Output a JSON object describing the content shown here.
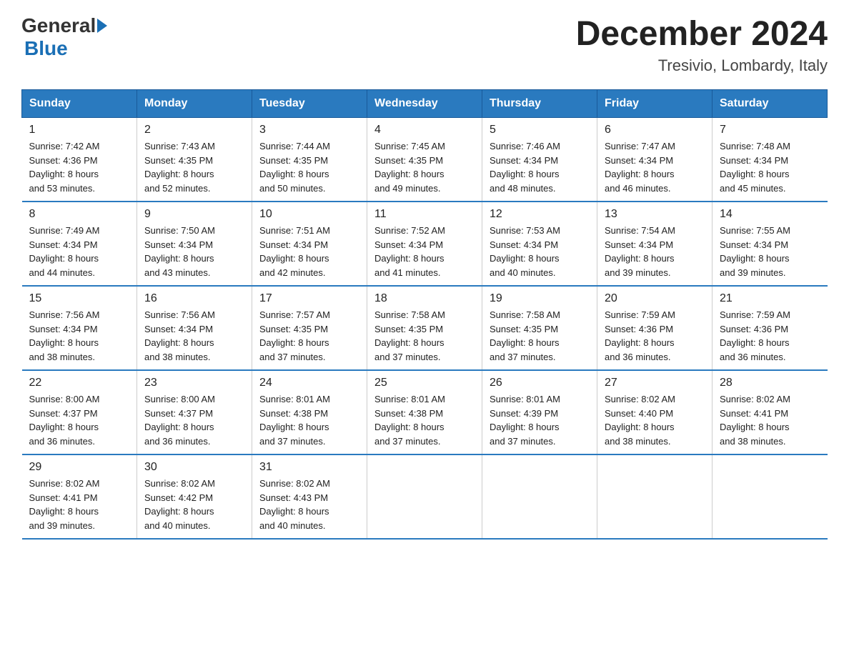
{
  "header": {
    "logo_general": "General",
    "logo_blue": "Blue",
    "month_title": "December 2024",
    "location": "Tresivio, Lombardy, Italy"
  },
  "days_of_week": [
    "Sunday",
    "Monday",
    "Tuesday",
    "Wednesday",
    "Thursday",
    "Friday",
    "Saturday"
  ],
  "weeks": [
    [
      {
        "day": "1",
        "sunrise": "7:42 AM",
        "sunset": "4:36 PM",
        "daylight": "8 hours and 53 minutes."
      },
      {
        "day": "2",
        "sunrise": "7:43 AM",
        "sunset": "4:35 PM",
        "daylight": "8 hours and 52 minutes."
      },
      {
        "day": "3",
        "sunrise": "7:44 AM",
        "sunset": "4:35 PM",
        "daylight": "8 hours and 50 minutes."
      },
      {
        "day": "4",
        "sunrise": "7:45 AM",
        "sunset": "4:35 PM",
        "daylight": "8 hours and 49 minutes."
      },
      {
        "day": "5",
        "sunrise": "7:46 AM",
        "sunset": "4:34 PM",
        "daylight": "8 hours and 48 minutes."
      },
      {
        "day": "6",
        "sunrise": "7:47 AM",
        "sunset": "4:34 PM",
        "daylight": "8 hours and 46 minutes."
      },
      {
        "day": "7",
        "sunrise": "7:48 AM",
        "sunset": "4:34 PM",
        "daylight": "8 hours and 45 minutes."
      }
    ],
    [
      {
        "day": "8",
        "sunrise": "7:49 AM",
        "sunset": "4:34 PM",
        "daylight": "8 hours and 44 minutes."
      },
      {
        "day": "9",
        "sunrise": "7:50 AM",
        "sunset": "4:34 PM",
        "daylight": "8 hours and 43 minutes."
      },
      {
        "day": "10",
        "sunrise": "7:51 AM",
        "sunset": "4:34 PM",
        "daylight": "8 hours and 42 minutes."
      },
      {
        "day": "11",
        "sunrise": "7:52 AM",
        "sunset": "4:34 PM",
        "daylight": "8 hours and 41 minutes."
      },
      {
        "day": "12",
        "sunrise": "7:53 AM",
        "sunset": "4:34 PM",
        "daylight": "8 hours and 40 minutes."
      },
      {
        "day": "13",
        "sunrise": "7:54 AM",
        "sunset": "4:34 PM",
        "daylight": "8 hours and 39 minutes."
      },
      {
        "day": "14",
        "sunrise": "7:55 AM",
        "sunset": "4:34 PM",
        "daylight": "8 hours and 39 minutes."
      }
    ],
    [
      {
        "day": "15",
        "sunrise": "7:56 AM",
        "sunset": "4:34 PM",
        "daylight": "8 hours and 38 minutes."
      },
      {
        "day": "16",
        "sunrise": "7:56 AM",
        "sunset": "4:34 PM",
        "daylight": "8 hours and 38 minutes."
      },
      {
        "day": "17",
        "sunrise": "7:57 AM",
        "sunset": "4:35 PM",
        "daylight": "8 hours and 37 minutes."
      },
      {
        "day": "18",
        "sunrise": "7:58 AM",
        "sunset": "4:35 PM",
        "daylight": "8 hours and 37 minutes."
      },
      {
        "day": "19",
        "sunrise": "7:58 AM",
        "sunset": "4:35 PM",
        "daylight": "8 hours and 37 minutes."
      },
      {
        "day": "20",
        "sunrise": "7:59 AM",
        "sunset": "4:36 PM",
        "daylight": "8 hours and 36 minutes."
      },
      {
        "day": "21",
        "sunrise": "7:59 AM",
        "sunset": "4:36 PM",
        "daylight": "8 hours and 36 minutes."
      }
    ],
    [
      {
        "day": "22",
        "sunrise": "8:00 AM",
        "sunset": "4:37 PM",
        "daylight": "8 hours and 36 minutes."
      },
      {
        "day": "23",
        "sunrise": "8:00 AM",
        "sunset": "4:37 PM",
        "daylight": "8 hours and 36 minutes."
      },
      {
        "day": "24",
        "sunrise": "8:01 AM",
        "sunset": "4:38 PM",
        "daylight": "8 hours and 37 minutes."
      },
      {
        "day": "25",
        "sunrise": "8:01 AM",
        "sunset": "4:38 PM",
        "daylight": "8 hours and 37 minutes."
      },
      {
        "day": "26",
        "sunrise": "8:01 AM",
        "sunset": "4:39 PM",
        "daylight": "8 hours and 37 minutes."
      },
      {
        "day": "27",
        "sunrise": "8:02 AM",
        "sunset": "4:40 PM",
        "daylight": "8 hours and 38 minutes."
      },
      {
        "day": "28",
        "sunrise": "8:02 AM",
        "sunset": "4:41 PM",
        "daylight": "8 hours and 38 minutes."
      }
    ],
    [
      {
        "day": "29",
        "sunrise": "8:02 AM",
        "sunset": "4:41 PM",
        "daylight": "8 hours and 39 minutes."
      },
      {
        "day": "30",
        "sunrise": "8:02 AM",
        "sunset": "4:42 PM",
        "daylight": "8 hours and 40 minutes."
      },
      {
        "day": "31",
        "sunrise": "8:02 AM",
        "sunset": "4:43 PM",
        "daylight": "8 hours and 40 minutes."
      },
      null,
      null,
      null,
      null
    ]
  ],
  "labels": {
    "sunrise": "Sunrise:",
    "sunset": "Sunset:",
    "daylight": "Daylight:"
  }
}
